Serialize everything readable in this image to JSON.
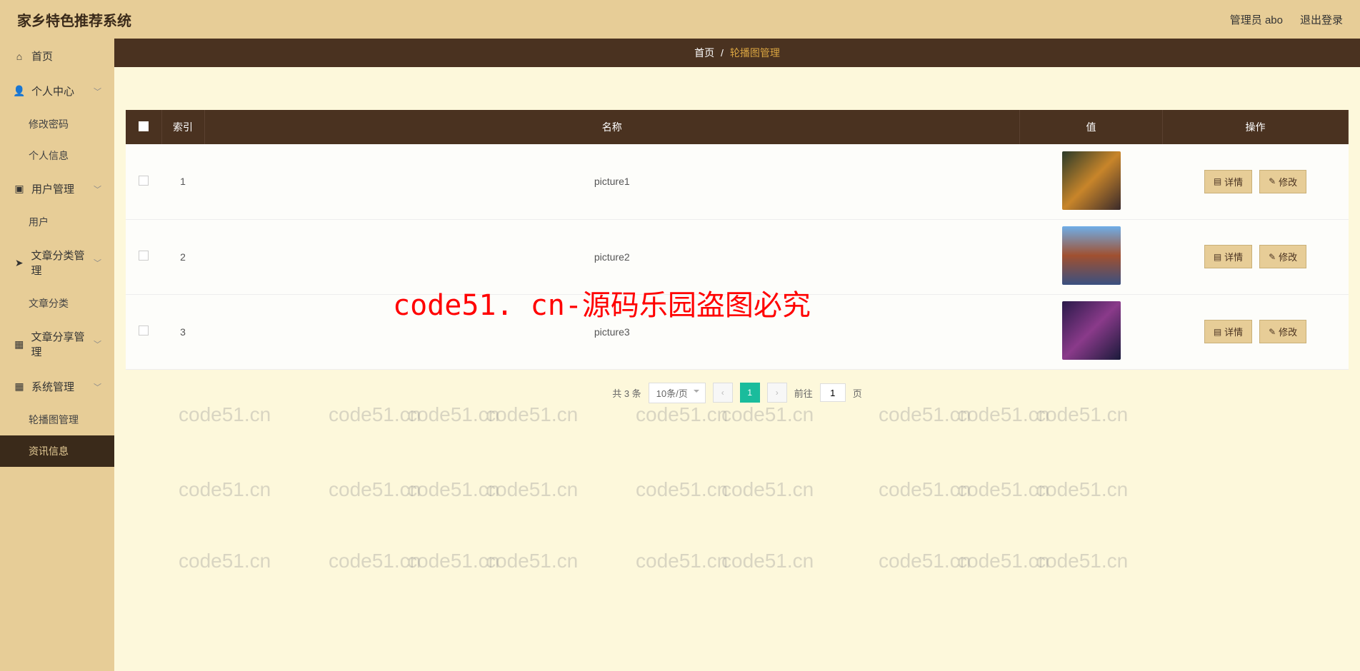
{
  "header": {
    "title": "家乡特色推荐系统",
    "admin_label": "管理员 abo",
    "logout_label": "退出登录"
  },
  "sidebar": {
    "items": [
      {
        "icon": "home",
        "label": "首页",
        "type": "item"
      },
      {
        "icon": "user",
        "label": "个人中心",
        "type": "group",
        "arrow": true
      },
      {
        "label": "修改密码",
        "type": "sub"
      },
      {
        "label": "个人信息",
        "type": "sub"
      },
      {
        "icon": "users",
        "label": "用户管理",
        "type": "group",
        "arrow": true
      },
      {
        "label": "用户",
        "type": "sub"
      },
      {
        "icon": "send",
        "label": "文章分类管理",
        "type": "group",
        "arrow": true
      },
      {
        "label": "文章分类",
        "type": "sub"
      },
      {
        "icon": "grid",
        "label": "文章分享管理",
        "type": "group",
        "arrow": true
      },
      {
        "icon": "grid",
        "label": "系统管理",
        "type": "group",
        "arrow": true
      },
      {
        "label": "轮播图管理",
        "type": "sub"
      },
      {
        "label": "资讯信息",
        "type": "sub",
        "active": true
      }
    ]
  },
  "breadcrumb": {
    "home": "首页",
    "sep": "/",
    "current": "轮播图管理"
  },
  "table": {
    "headers": {
      "index": "索引",
      "name": "名称",
      "value": "值",
      "action": "操作"
    },
    "rows": [
      {
        "idx": "1",
        "name": "picture1",
        "thumb": "t1"
      },
      {
        "idx": "2",
        "name": "picture2",
        "thumb": "t2"
      },
      {
        "idx": "3",
        "name": "picture3",
        "thumb": "t3"
      }
    ],
    "actions": {
      "detail": "详情",
      "edit": "修改"
    }
  },
  "pagination": {
    "total": "共 3 条",
    "page_size": "10条/页",
    "current": "1",
    "goto_prefix": "前往",
    "goto_value": "1",
    "goto_suffix": "页"
  },
  "watermark_text": "code51.cn",
  "big_watermark": "code51. cn-源码乐园盗图必究"
}
